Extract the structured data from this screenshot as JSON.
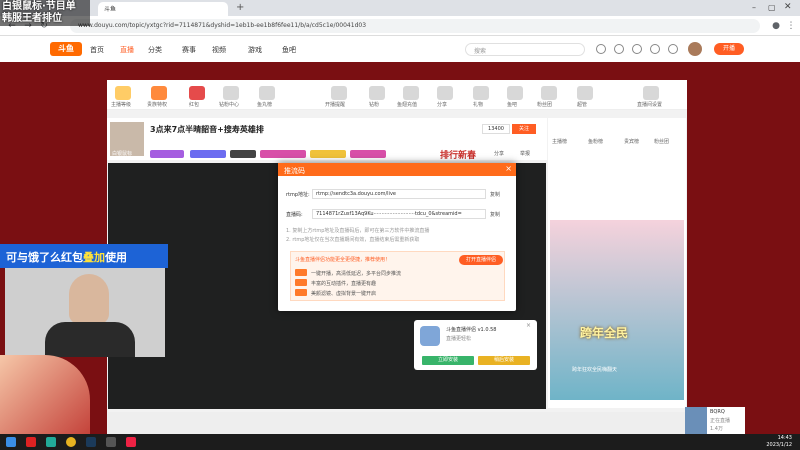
{
  "overlay_title": {
    "line1": "白银鼠标·节目单",
    "line2": "韩服王者排位"
  },
  "browser": {
    "url": "www.douyu.com/topic/yxtgc?rid=7114871&dyshid=1eb1b-ee1b8f6fee11/b/a/cd5c1e/00041d03",
    "tab_label": "斗鱼",
    "new_tab": "+"
  },
  "site_nav": {
    "logo": "斗鱼",
    "items": [
      "首页",
      "直播",
      "分类",
      "赛事",
      "视频",
      "游戏",
      "鱼吧"
    ],
    "active_index": 1,
    "search_placeholder": "搜索",
    "start_live": "开播"
  },
  "gift_bar": {
    "items": [
      "主播等级",
      "贵族特权",
      "红包",
      "钻粉中心",
      "鱼丸榜",
      "开播提醒",
      "钻粉",
      "鱼翅充值",
      "分享",
      "礼物",
      "鱼吧",
      "粉丝团",
      "超管",
      "直播间设置"
    ]
  },
  "stream": {
    "title": "3点来7点半晴韶音+搜寿英雄排",
    "anchor_name": "白银鼠标",
    "follow_count": "13400",
    "follow_btn": "关注",
    "report": "举报",
    "share": "分享",
    "banner": "排行新春"
  },
  "chat": {
    "tabs": [
      "主播榜",
      "鱼粉榜",
      "贵宾榜",
      "粉丝团"
    ],
    "poster_text": "跨年全民",
    "poster_sub": "跨年狂欢全民嗨翻天"
  },
  "modal": {
    "title": "推流码",
    "close": "×",
    "rtmp_label": "rtmp地址:",
    "rtmp_value": "rtmp://sendtc3a.douyu.com/live",
    "stream_label": "直播码:",
    "stream_value": "7114871rZusf13Aq9Ku··························tdcu_0&streamid=",
    "copy": "复制",
    "note1": "1. 复制上方rtmp地址及直播码后，即可在第三方软件中推流直播",
    "note2": "2. rtmp地址仅在当次直播期间有效，直播结束后需重新获取",
    "promo_head": "斗鱼直播伴侣功能更全更便捷，推荐使用！",
    "promo_btn": "打开直播伴侣",
    "promo_lines": [
      "一键开播，高清低延迟，多平台同步推流",
      "丰富的互动插件，直播更有趣",
      "美颜滤镜、虚拟背景一键开启"
    ]
  },
  "app_popup": {
    "title": "斗鱼直播伴侣 v1.0.58",
    "sub": "直播更轻松",
    "btn_install": "立即安装",
    "btn_later": "稍后安装"
  },
  "caption": {
    "pre": "可与饿了么红包",
    "highlight": "叠加",
    "post": "使用"
  },
  "mini_panel": {
    "title": "BQRQ",
    "sub": "正在直播",
    "count": "1.4万"
  },
  "taskbar": {
    "time": "14:43",
    "date": "2023/1/12"
  },
  "colors": {
    "accent": "#ff5d23",
    "page_bg": "#7a0f12",
    "caption_bg": "#1d63d6",
    "modal_head": "#ff6b1a"
  }
}
